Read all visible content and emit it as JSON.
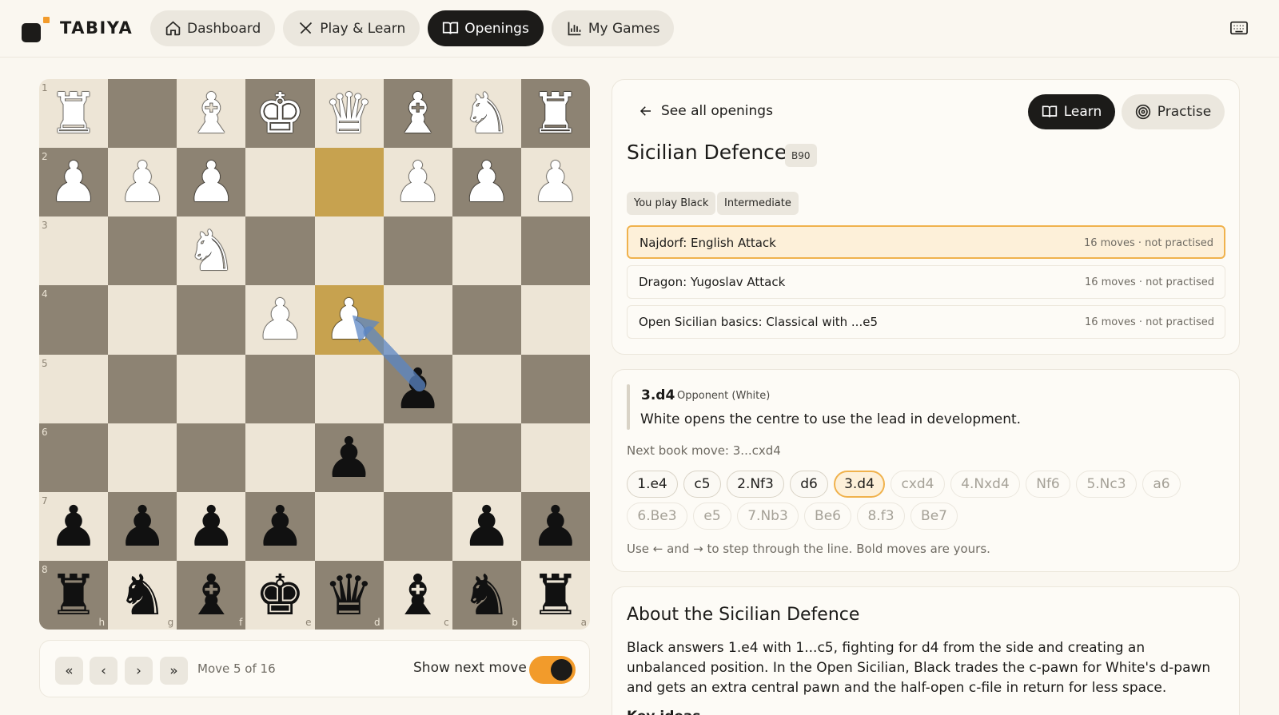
{
  "app": {
    "name": "TABIYA"
  },
  "nav": [
    {
      "label": "Dashboard",
      "active": false
    },
    {
      "label": "Play & Learn",
      "active": false
    },
    {
      "label": "Openings",
      "active": true
    },
    {
      "label": "My Games",
      "active": false
    }
  ],
  "board": {
    "orientation": "black",
    "rank_labels": [
      "1",
      "2",
      "3",
      "4",
      "5",
      "6",
      "7",
      "8"
    ],
    "file_labels": [
      "h",
      "g",
      "f",
      "e",
      "d",
      "c",
      "b",
      "a"
    ],
    "rows": [
      [
        "wR",
        "",
        "wB",
        "wK",
        "wQ",
        "wB",
        "wN",
        "wR"
      ],
      [
        "wP",
        "wP",
        "wP",
        "",
        "",
        "wP",
        "wP",
        "wP"
      ],
      [
        "",
        "",
        "wN",
        "",
        "",
        "",
        "",
        ""
      ],
      [
        "",
        "",
        "",
        "wP",
        "wP",
        "",
        "",
        ""
      ],
      [
        "",
        "",
        "",
        "",
        "",
        "bP",
        "",
        ""
      ],
      [
        "",
        "",
        "",
        "",
        "bP",
        "",
        "",
        ""
      ],
      [
        "bP",
        "bP",
        "bP",
        "bP",
        "",
        "",
        "bP",
        "bP"
      ],
      [
        "bR",
        "bN",
        "bB",
        "bK",
        "bQ",
        "bB",
        "bN",
        "bR"
      ]
    ],
    "highlight_squares": [
      "d2",
      "d4"
    ],
    "arrow": {
      "from": "c5",
      "to": "d4",
      "color": "#5b86c4"
    }
  },
  "controls": {
    "first": "«",
    "prev": "‹",
    "next": "›",
    "last": "»",
    "move_counter": "Move 5 of 16",
    "show_next_label": "Show next move",
    "show_next_on": true
  },
  "opening": {
    "back_label": "See all openings",
    "learn_label": "Learn",
    "practise_label": "Practise",
    "title": "Sicilian Defence",
    "eco": "B90",
    "tags": [
      "You play Black",
      "Intermediate"
    ],
    "lines": [
      {
        "name": "Najdorf: English Attack",
        "meta": "16 moves · not practised",
        "selected": true
      },
      {
        "name": "Dragon: Yugoslav Attack",
        "meta": "16 moves · not practised",
        "selected": false
      },
      {
        "name": "Open Sicilian basics: Classical with ...e5",
        "meta": "16 moves · not practised",
        "selected": false
      }
    ]
  },
  "current_move": {
    "san": "3.d4",
    "by": "Opponent (White)",
    "description": "White opens the centre to use the lead in development.",
    "next_book": "Next book move: 3...cxd4",
    "chips": [
      {
        "label": "1.e4",
        "state": "done"
      },
      {
        "label": "c5",
        "state": "done"
      },
      {
        "label": "2.Nf3",
        "state": "done"
      },
      {
        "label": "d6",
        "state": "done"
      },
      {
        "label": "3.d4",
        "state": "current"
      },
      {
        "label": "cxd4",
        "state": "future"
      },
      {
        "label": "4.Nxd4",
        "state": "future"
      },
      {
        "label": "Nf6",
        "state": "future"
      },
      {
        "label": "5.Nc3",
        "state": "future"
      },
      {
        "label": "a6",
        "state": "future"
      },
      {
        "label": "6.Be3",
        "state": "future"
      },
      {
        "label": "e5",
        "state": "future"
      },
      {
        "label": "7.Nb3",
        "state": "future"
      },
      {
        "label": "Be6",
        "state": "future"
      },
      {
        "label": "8.f3",
        "state": "future"
      },
      {
        "label": "Be7",
        "state": "future"
      }
    ],
    "hint": "Use ← and → to step through the line. Bold moves are yours."
  },
  "about": {
    "title": "About the Sicilian Defence",
    "body": "Black answers 1.e4 with 1...c5, fighting for d4 from the side and creating an unbalanced position. In the Open Sicilian, Black trades the c-pawn for White's d-pawn and gets an extra central pawn and the half-open c-file in return for less space.",
    "subheading": "Key ideas"
  },
  "colors": {
    "accent": "#f29b2b",
    "board_light": "#ede5d6",
    "board_dark": "#8d8373",
    "highlight": "#c7a24f",
    "ink": "#1c1b19"
  },
  "icons": {
    "dashboard": "home-icon",
    "play": "crossed-swords-icon",
    "openings": "open-book-icon",
    "games": "bar-chart-icon",
    "keyboard": "keyboard-icon",
    "back": "arrow-left-icon",
    "practise": "target-icon"
  }
}
